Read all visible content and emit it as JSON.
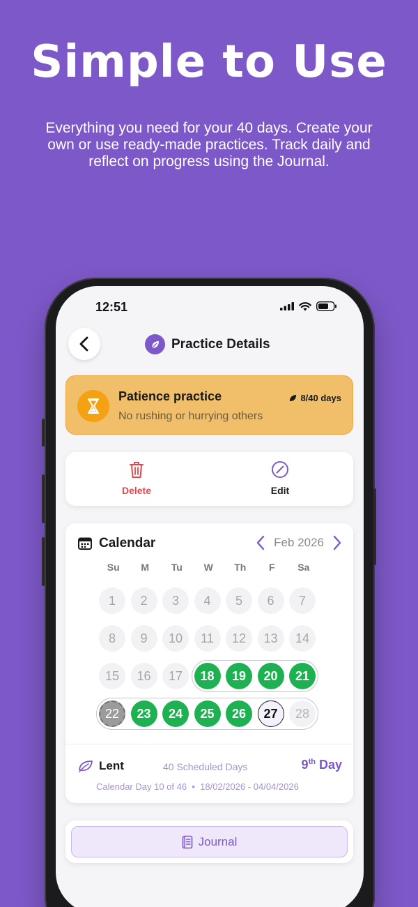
{
  "hero": {
    "headline": "Simple to Use",
    "subtitle": "Everything you need for your 40 days. Create your own or use ready-made practices. Track daily and reflect on progress using the Journal."
  },
  "status_bar": {
    "time": "12:51",
    "icons": [
      "cellular-icon",
      "wifi-icon",
      "battery-icon"
    ]
  },
  "nav": {
    "title": "Practice Details",
    "back_icon": "chevron-left-icon",
    "title_icon": "leaf-icon"
  },
  "practice": {
    "name": "Patience practice",
    "description": "No rushing or hurrying others",
    "progress_label": "8/40 days",
    "progress": {
      "done": 8,
      "total": 40
    },
    "icon": "hourglass-icon"
  },
  "actions": {
    "delete_label": "Delete",
    "edit_label": "Edit"
  },
  "calendar": {
    "title": "Calendar",
    "month": "Feb 2026",
    "weekdays": [
      "Su",
      "M",
      "Tu",
      "W",
      "Th",
      "F",
      "Sa"
    ],
    "weeks": [
      [
        "1",
        "2",
        "3",
        "4",
        "5",
        "6",
        "7"
      ],
      [
        "8",
        "9",
        "10",
        "11",
        "12",
        "13",
        "14"
      ],
      [
        "15",
        "16",
        "17",
        "18",
        "19",
        "20",
        "21"
      ],
      [
        "22",
        "23",
        "24",
        "25",
        "26",
        "27",
        "28"
      ]
    ],
    "states": [
      [
        "muted",
        "muted",
        "muted",
        "muted",
        "muted",
        "muted",
        "muted"
      ],
      [
        "muted",
        "muted",
        "muted",
        "muted",
        "muted",
        "muted",
        "muted"
      ],
      [
        "muted",
        "muted",
        "muted",
        "done",
        "done",
        "done",
        "done"
      ],
      [
        "missed",
        "done",
        "done",
        "done",
        "done",
        "today",
        "future"
      ]
    ]
  },
  "season": {
    "name": "Lent",
    "scheduled": "40 Scheduled Days",
    "day_number": "9",
    "day_suffix": "th",
    "day_word": "Day",
    "calendar_day": "Calendar Day 10 of 46",
    "separator": "•",
    "date_range": "18/02/2026 - 04/04/2026"
  },
  "journal": {
    "label": "Journal"
  },
  "colors": {
    "brand": "#7d58c8",
    "done": "#1db151",
    "warning": "#f1bf6a",
    "delete": "#e0474c"
  }
}
